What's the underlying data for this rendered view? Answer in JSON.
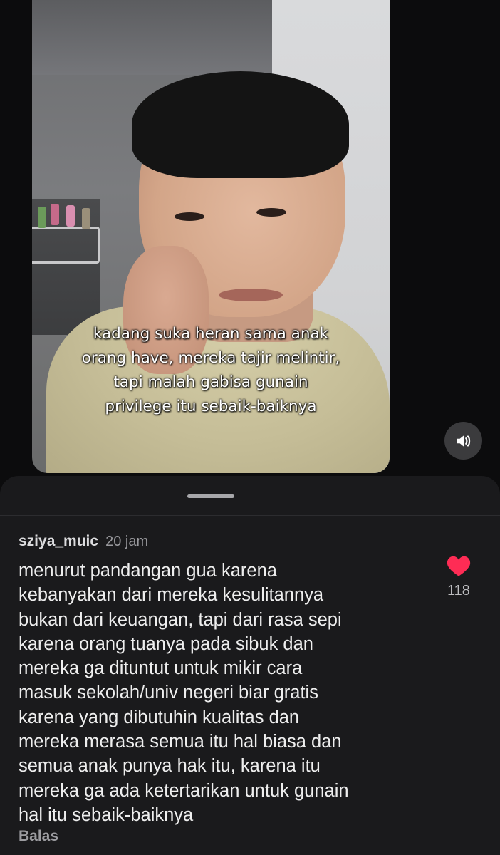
{
  "video": {
    "caption_lines": [
      "kadang suka heran sama anak",
      "orang have, mereka tajir melintir,",
      "tapi malah gabisa gunain",
      "privilege itu sebaik-baiknya"
    ],
    "sound_icon": "speaker-volume-icon"
  },
  "comment": {
    "username": "sziya_muic",
    "time": "20 jam",
    "text_lines": [
      "menurut pandangan gua karena",
      "kebanyakan dari mereka kesulitannya",
      "bukan dari keuangan, tapi dari rasa sepi",
      "karena orang tuanya pada sibuk dan",
      "mereka ga dituntut untuk mikir cara",
      "masuk sekolah/univ negeri biar gratis",
      "karena yang dibutuhin kualitas dan",
      "mereka merasa semua itu hal biasa dan",
      "semua anak punya hak itu, karena itu",
      "mereka ga ada ketertarikan untuk gunain",
      "hal itu sebaik-baiknya"
    ],
    "like_count": "118",
    "like_icon": "heart-icon",
    "like_color": "#fe2c55",
    "reply_label": "Balas"
  },
  "colors": {
    "panel_bg": "#1a1a1c",
    "page_bg": "#0b0b0c"
  }
}
